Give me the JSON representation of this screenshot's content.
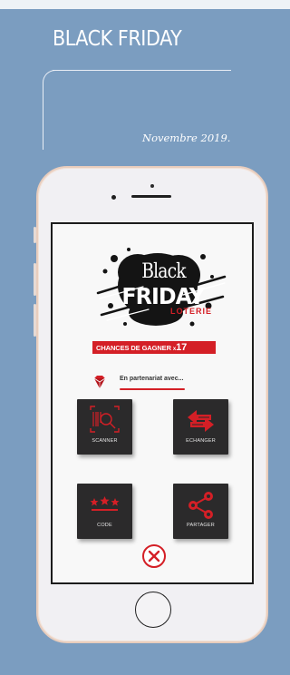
{
  "header": {
    "title": "BLACK FRIDAY",
    "date": "Novembre 2019."
  },
  "app": {
    "logo": {
      "line1": "Black",
      "line2": "FRIDAY",
      "line3": "LOTERIE"
    },
    "chances": {
      "label": "CHANCES DE GAGNER",
      "multiplier": "x",
      "value": "17"
    },
    "partner_text": "En partenariat avec...",
    "tiles": [
      {
        "label": "SCANNER",
        "icon": "scan-icon"
      },
      {
        "label": "ECHANGER",
        "icon": "exchange-icon"
      },
      {
        "label": "CODE",
        "icon": "code-stars-icon"
      },
      {
        "label": "PARTAGER",
        "icon": "share-icon"
      }
    ],
    "close_icon": "close-icon"
  },
  "colors": {
    "background": "#7b9dc0",
    "accent": "#d41f26",
    "tile": "#2b2a2b"
  }
}
